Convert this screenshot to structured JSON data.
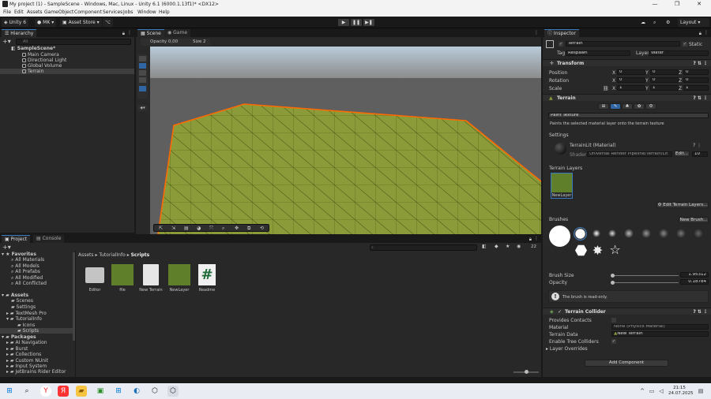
{
  "window": {
    "title": "My project (1) - SampleScene - Windows, Mac, Linux - Unity 6.1 (6000.1.13f1)* <DX12>"
  },
  "menu": [
    "File",
    "Edit",
    "Assets",
    "GameObject",
    "Component",
    "Services",
    "Jobs",
    "Window",
    "Help"
  ],
  "toolbar": {
    "unity_label": "Unity 6",
    "account": "MK",
    "asset_store": "Asset Store",
    "layout": "Layout"
  },
  "hierarchy": {
    "tab": "Hierarchy",
    "search_placeholder": "All",
    "scene": "SampleScene*",
    "items": [
      "Main Camera",
      "Directional Light",
      "Global Volume",
      "Terrain"
    ]
  },
  "scene_view": {
    "tab_scene": "Scene",
    "tab_game": "Game",
    "opacity": "Opacity 0,00",
    "size": "Size 2"
  },
  "project": {
    "tab_project": "Project",
    "tab_console": "Console",
    "count": "22",
    "favorites_title": "Favorites",
    "favorites": [
      "All Materials",
      "All Models",
      "All Prefabs",
      "All Modified",
      "All Conflicted"
    ],
    "assets_title": "Assets",
    "assets": [
      "Scenes",
      "Settings",
      "TextMesh Pro",
      "TutorialInfo",
      "Icons",
      "Scripts"
    ],
    "packages_title": "Packages",
    "packages": [
      "AI Navigation",
      "Burst",
      "Collections",
      "Custom NUnit",
      "Input System",
      "JetBrains Rider Editor"
    ],
    "breadcrumb": [
      "Assets",
      "TutorialInfo",
      "Scripts"
    ],
    "files": [
      {
        "name": "Editor",
        "kind": "folder"
      },
      {
        "name": "file",
        "kind": "grass"
      },
      {
        "name": "New Terrain",
        "kind": "doc"
      },
      {
        "name": "NewLayer",
        "kind": "grass"
      },
      {
        "name": "Readme",
        "kind": "script"
      }
    ]
  },
  "inspector": {
    "tab": "Inspector",
    "object_name": "Terrain",
    "static_label": "Static",
    "tag_label": "Tag",
    "tag_value": "Respawn",
    "layer_label": "Layer",
    "layer_value": "Water",
    "transform": {
      "title": "Transform",
      "position_label": "Position",
      "rotation_label": "Rotation",
      "scale_label": "Scale",
      "position": [
        "0",
        "0",
        "0"
      ],
      "rotation": [
        "0",
        "0",
        "0"
      ],
      "scale": [
        "1",
        "1",
        "1"
      ],
      "axes": [
        "X",
        "Y",
        "Z"
      ]
    },
    "terrain": {
      "title": "Terrain",
      "tool": "Paint Texture",
      "tool_hint": "Paints the selected material layer onto the terrain texture",
      "settings_label": "Settings",
      "material_name": "TerrainLit (Material)",
      "shader_label": "Shader",
      "shader_value": "Universal Render Pipeline/Terrain/Lit",
      "edit_button": "Edit...",
      "render_queue": "10",
      "layers_label": "Terrain Layers",
      "layer_name": "NewLayer",
      "edit_layers_button": "Edit Terrain Layers...",
      "brushes_label": "Brushes",
      "new_brush_button": "New Brush...",
      "brush_size_label": "Brush Size",
      "brush_size_value": "1.95312",
      "opacity_label": "Opacity",
      "opacity_value": "0.18784",
      "info": "The brush is read-only."
    },
    "collider": {
      "title": "Terrain Collider",
      "provides_contacts": "Provides Contacts",
      "material_label": "Material",
      "material_value": "None (Physics Material)",
      "terrain_data_label": "Terrain Data",
      "terrain_data_value": "New Terrain",
      "enable_tree_label": "Enable Tree Colliders",
      "layer_overrides": "Layer Overrides"
    },
    "add_component": "Add Component"
  },
  "taskbar": {
    "time": "21:15",
    "date": "24.07.2025"
  },
  "colors": {
    "accent": "#3a79bb",
    "selection": "#2c5d87",
    "terrain": "#8c9b3a",
    "outline": "#ff6a00"
  }
}
